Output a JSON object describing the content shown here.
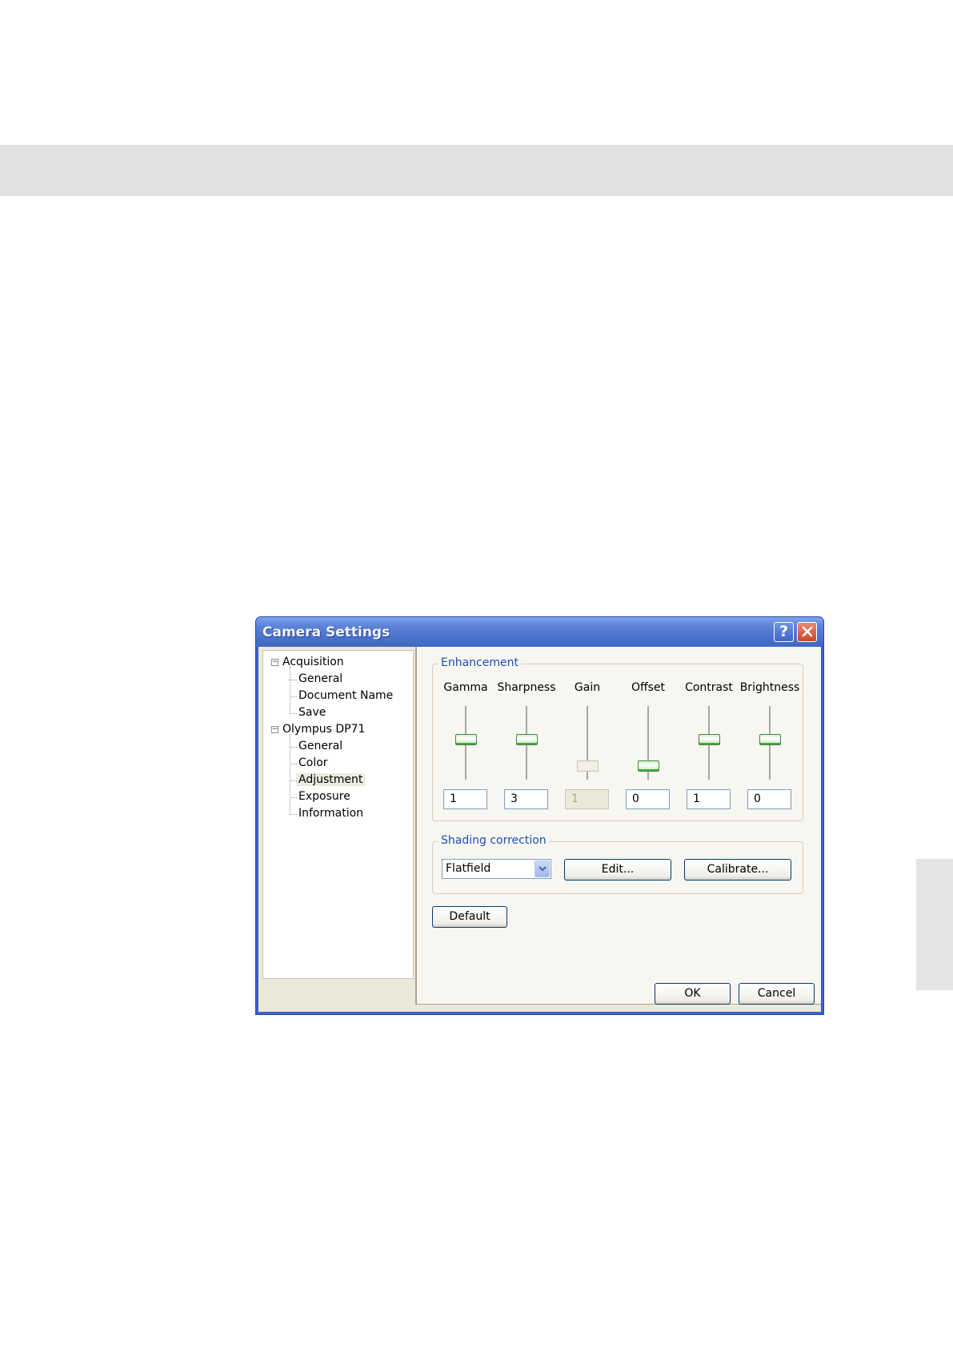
{
  "dialog": {
    "title": "Camera Settings",
    "help_label": "?",
    "tree": [
      {
        "label": "Acquisition",
        "level": 0,
        "expanded": true
      },
      {
        "label": "General",
        "level": 1
      },
      {
        "label": "Document Name",
        "level": 1
      },
      {
        "label": "Save",
        "level": 1
      },
      {
        "label": "Olympus DP71",
        "level": 0,
        "expanded": true
      },
      {
        "label": "General",
        "level": 1
      },
      {
        "label": "Color",
        "level": 1
      },
      {
        "label": "Adjustment",
        "level": 1,
        "selected": true
      },
      {
        "label": "Exposure",
        "level": 1
      },
      {
        "label": "Information",
        "level": 1
      }
    ],
    "enhancement": {
      "title": "Enhancement",
      "controls": [
        {
          "label": "Gamma",
          "value": "1",
          "enabled": true,
          "level": 0.5
        },
        {
          "label": "Sharpness",
          "value": "3",
          "enabled": true,
          "level": 0.5
        },
        {
          "label": "Gain",
          "value": "1",
          "enabled": false,
          "level": 0.0
        },
        {
          "label": "Offset",
          "value": "0",
          "enabled": true,
          "level": 0.0
        },
        {
          "label": "Contrast",
          "value": "1",
          "enabled": true,
          "level": 0.5
        },
        {
          "label": "Brightness",
          "value": "0",
          "enabled": true,
          "level": 0.5
        }
      ]
    },
    "shading": {
      "title": "Shading correction",
      "selected": "Flatfield",
      "edit_label": "Edit...",
      "calibrate_label": "Calibrate..."
    },
    "default_label": "Default",
    "ok_label": "OK",
    "cancel_label": "Cancel"
  }
}
